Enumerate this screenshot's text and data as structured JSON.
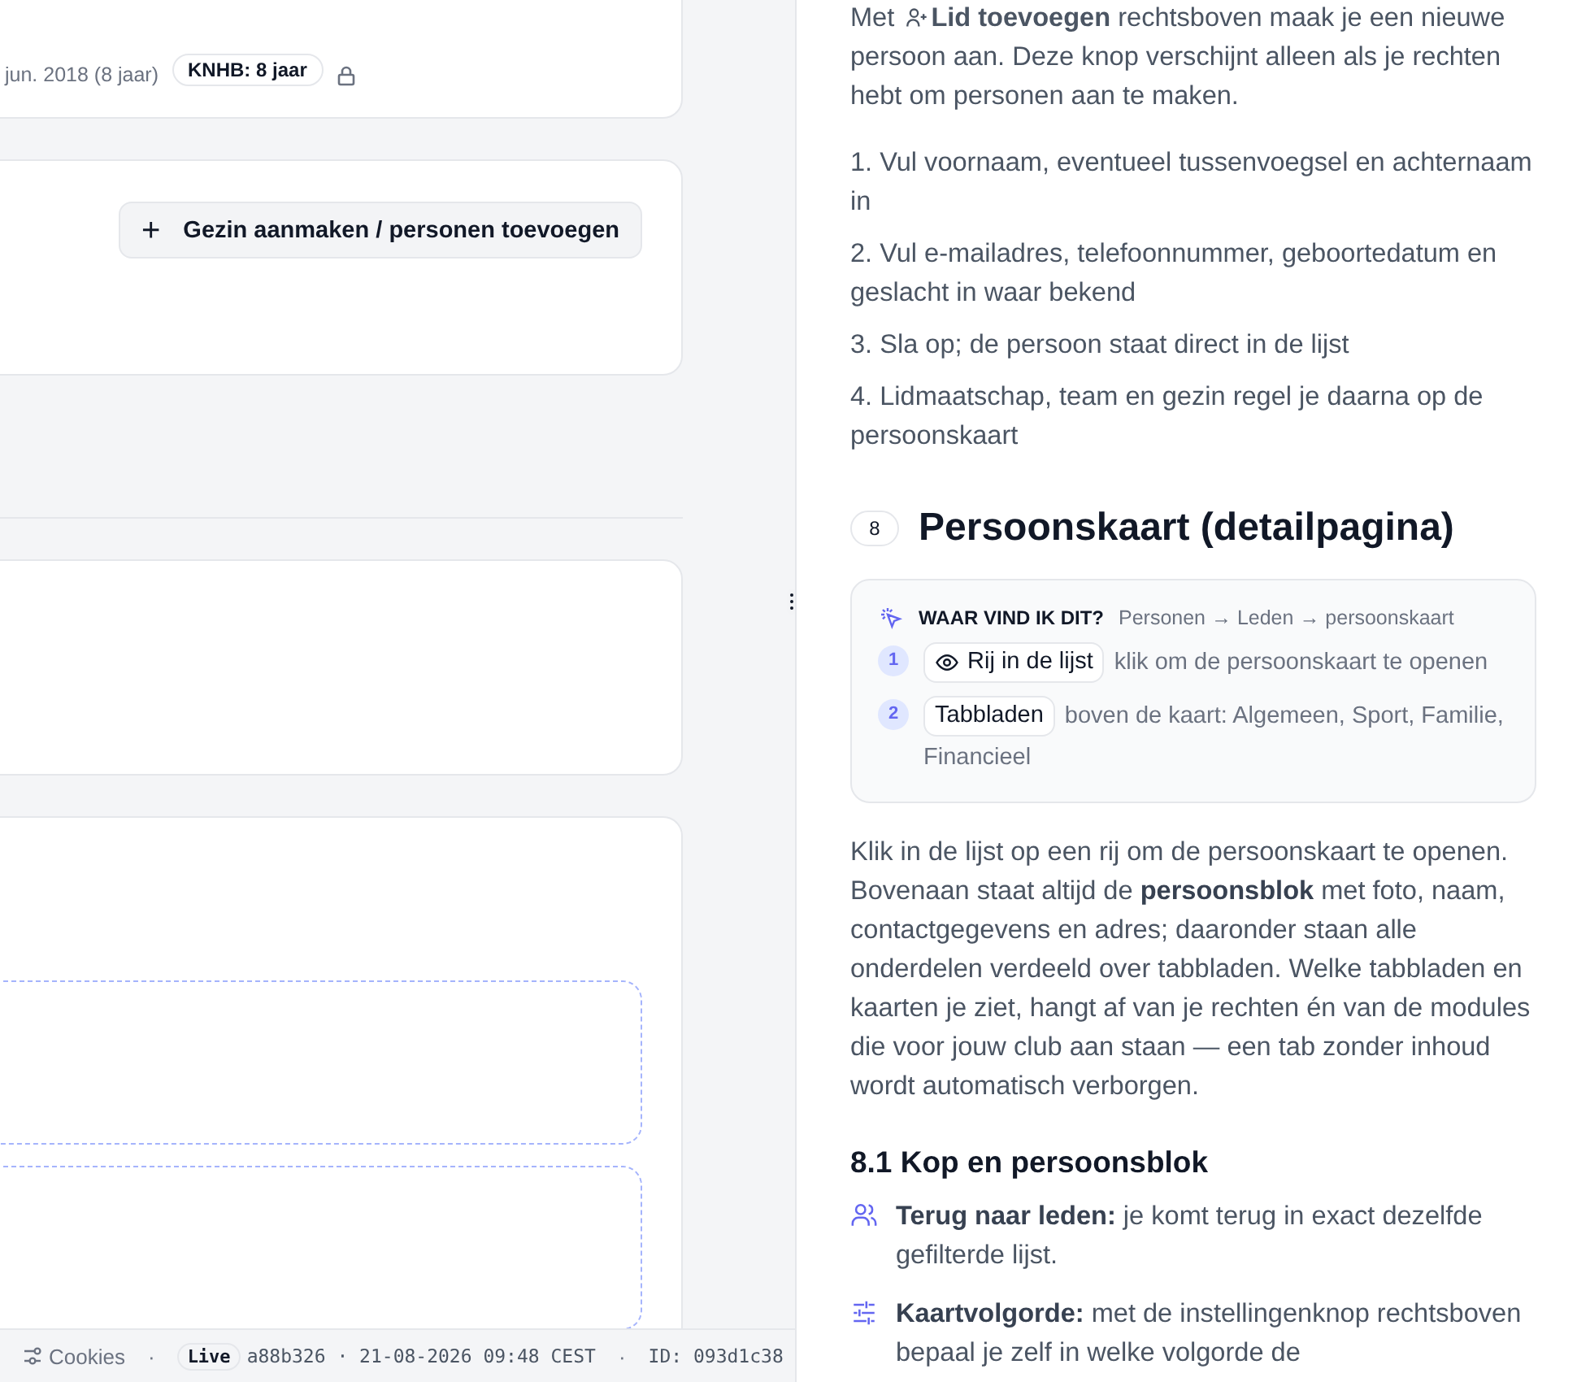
{
  "profile_card": {
    "birth_date": "jun. 2018 (8 jaar)",
    "membership_badge": "KNHB: 8 jaar",
    "locked": true
  },
  "family_card": {
    "button": {
      "icon": "+",
      "label": "Gezin aanmaken / personen toevoegen"
    }
  },
  "footer": {
    "cookies": "Cookies",
    "separators": [
      "·",
      "·"
    ],
    "env_badge": "Live",
    "build": "a88b326 · 21-08-2026 09:48 CEST",
    "id": "ID: 093d1c38"
  },
  "help": {
    "intro_before": "Met",
    "intro_rest": "**Lid toevoegen** rechtsboven maak je een nieuwe persoon aan. Deze knop verschijnt alleen als je rechten hebt om personen aan te maken.",
    "steps": [
      "1. Vul voornaam, eventueel tussenvoegsel en achternaam in",
      "2. Vul e-mailadres, telefoonnummer, geboortedatum en geslacht in waar bekend",
      "3. Sla op; de persoon staat direct in de lijst",
      "4. Lidmaatschap, team en gezin regel je daarna op de persoonskaart"
    ],
    "section": {
      "number": "8",
      "title": "Persoonskaart (detailpagina)"
    },
    "where": {
      "label": "WAAR VIND IK DIT?",
      "path": "Personen → Leden → persoonskaart",
      "items": [
        {
          "number": "1",
          "kind": "icon-chip",
          "chip": "Rij in de lijst",
          "text": "klik om de persoonskaart te openen"
        },
        {
          "number": "2",
          "kind": "plain-chip",
          "chip": "Tabbladen",
          "text": "boven de kaart: Algemeen, Sport, Familie, Financieel"
        }
      ]
    },
    "body": "Klik in de lijst op een rij om de persoonskaart te openen. Bovenaan staat altijd de **persoonsblok** met foto, naam, contactgegevens en adres; daaronder staan alle onderdelen verdeeld over tabbladen. Welke tabbladen en kaarten je ziet, hangt af van je rechten én van de modules die voor jouw club aan staan — een tab zonder inhoud wordt automatisch verborgen.",
    "subheading": "8.1 Kop en persoonsblok",
    "bullets": [
      {
        "text": "**Terug naar leden:** je komt terug in exact dezelfde gefilterde lijst."
      },
      {
        "text": "**Kaartvolgorde:** met de instellingenknop rechtsboven bepaal je zelf in welke volgorde de"
      }
    ]
  }
}
